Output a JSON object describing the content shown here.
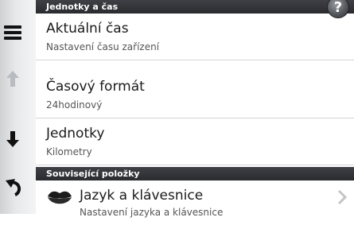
{
  "sidebar": {
    "menu_icon": "hamburger-menu-icon",
    "up_icon": "arrow-up-icon",
    "down_icon": "arrow-down-icon",
    "back_icon": "back-arrow-icon"
  },
  "section1": {
    "title": "Jednotky a čas",
    "help_label": "?"
  },
  "items": [
    {
      "title": "Aktuální čas",
      "subtitle": "Nastavení času zařízení"
    },
    {
      "title": "Časový formát",
      "subtitle": "24hodinový"
    },
    {
      "title": "Jednotky",
      "subtitle": "Kilometry"
    }
  ],
  "section2": {
    "title": "Související položky"
  },
  "related": [
    {
      "title": "Jazyk a klávesnice",
      "subtitle": "Nastavení jazyka a klávesnice",
      "icon": "lips-icon"
    }
  ],
  "colors": {
    "header_bg": "#2f3034",
    "sidebar_bg": "#e8e9ea",
    "disabled_arrow": "#b8bcc0"
  }
}
